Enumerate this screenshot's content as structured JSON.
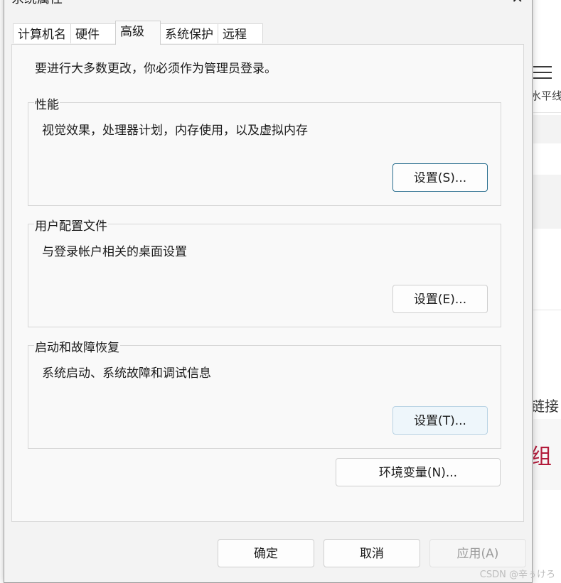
{
  "window": {
    "title": "系统属性",
    "close": "✕"
  },
  "tabs": [
    {
      "label": "计算机名"
    },
    {
      "label": "硬件"
    },
    {
      "label": "高级"
    },
    {
      "label": "系统保护"
    },
    {
      "label": "远程"
    }
  ],
  "active_tab": "高级",
  "notice": "要进行大多数更改，你必须作为管理员登录。",
  "groups": [
    {
      "title": "性能",
      "description": "视觉效果，处理器计划，内存使用，以及虚拟内存",
      "button": "设置(S)..."
    },
    {
      "title": "用户配置文件",
      "description": "与登录帐户相关的桌面设置",
      "button": "设置(E)..."
    },
    {
      "title": "启动和故障恢复",
      "description": "系统启动、系统故障和调试信息",
      "button": "设置(T)..."
    }
  ],
  "env_button": "环境变量(N)...",
  "buttons": {
    "ok": "确定",
    "cancel": "取消",
    "apply": "应用(A)"
  },
  "background": {
    "horizontal_line_label": "水平线",
    "link_label": "链接",
    "group_label": "组"
  },
  "watermark": "CSDN @辛ぅけろ",
  "colors": {
    "focus_border": "#2b6f8f",
    "dialog_bg": "#f3f3f3",
    "panel_bg": "#f9f9f9",
    "accent_red": "#b31b3b"
  }
}
